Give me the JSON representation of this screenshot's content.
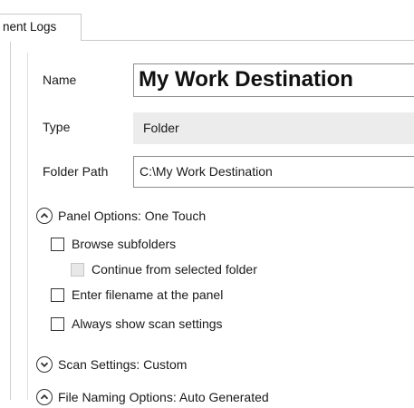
{
  "tab": {
    "label": "nent Logs"
  },
  "form": {
    "name_label": "Name",
    "name_value": "My Work Destination",
    "type_label": "Type",
    "type_value": "Folder",
    "path_label": "Folder Path",
    "path_value": "C:\\My Work Destination"
  },
  "panel_options": {
    "header": "Panel Options: One Touch",
    "items": [
      {
        "label": "Browse subfolders",
        "checked": false,
        "enabled": true
      },
      {
        "label": "Continue from selected folder",
        "checked": false,
        "enabled": false
      },
      {
        "label": "Enter filename at the panel",
        "checked": false,
        "enabled": true
      },
      {
        "label": "Always show scan settings",
        "checked": false,
        "enabled": true
      }
    ]
  },
  "scan_settings": {
    "header": "Scan Settings: Custom"
  },
  "file_naming": {
    "header": "File Naming Options: Auto Generated"
  },
  "icons": {
    "collapse": "chevron-up-circle-icon",
    "expand": "chevron-down-circle-icon"
  }
}
